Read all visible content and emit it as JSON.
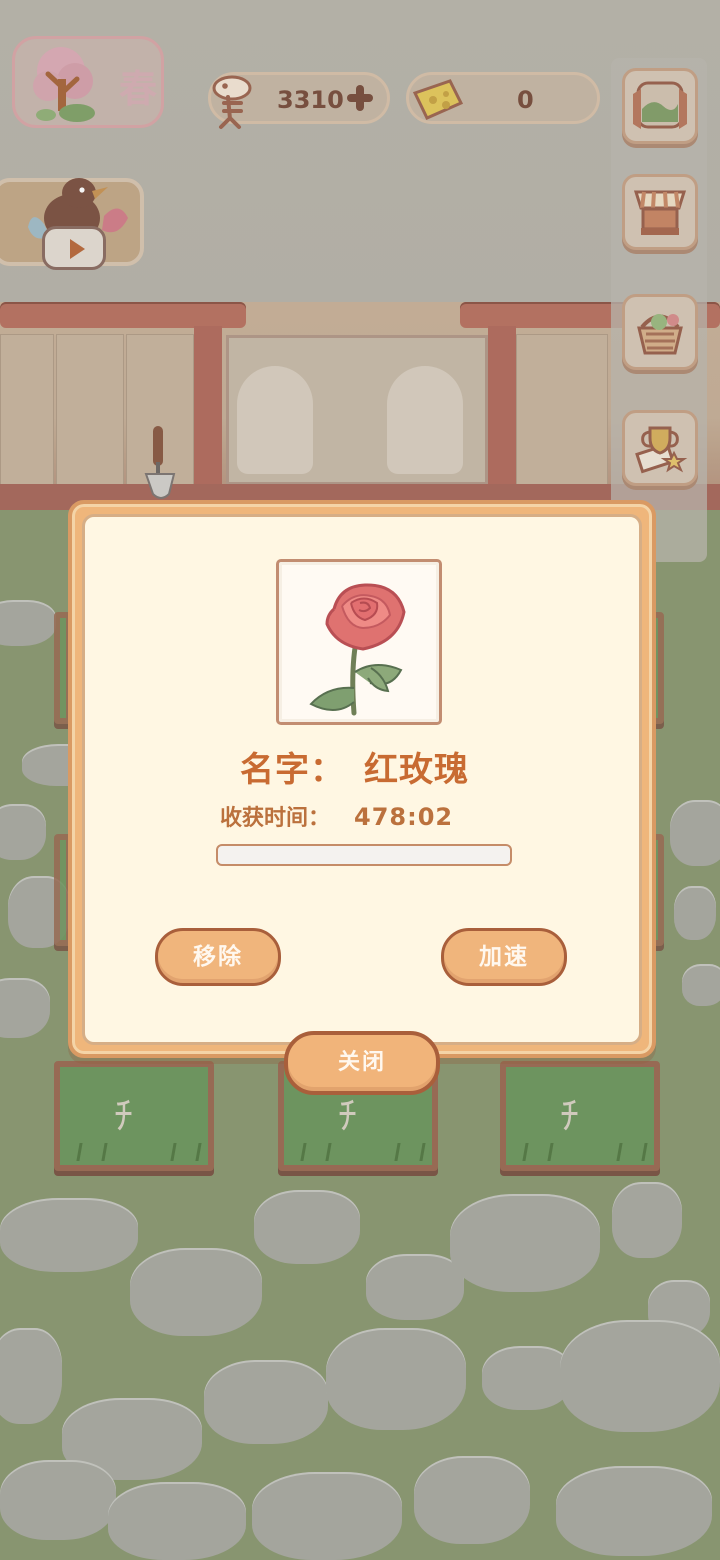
{
  "hud": {
    "season": "春",
    "fish_count": "3310",
    "cheese_count": "0"
  },
  "icons": {
    "tree": "tree-icon",
    "fish": "fish-bone-icon",
    "cheese": "cheese-icon",
    "plus": "plus-icon",
    "window": "window-icon",
    "shop": "shop-stall-icon",
    "basket": "basket-icon",
    "trophy": "trophy-icon",
    "bird": "bird-icon",
    "play": "play-icon",
    "trowel": "trowel-icon",
    "rose": "red-rose-icon"
  },
  "plant_panel": {
    "name_label": "名字：",
    "name_value": "红玫瑰",
    "harvest_label": "收获时间：",
    "harvest_value": "478:02",
    "progress_fraction": 0.0,
    "remove_button": "移除",
    "speed_button": "加速",
    "close_button": "关闭"
  },
  "colors": {
    "panel_border": "#efb67b",
    "panel_fill": "#fff7e3",
    "button_fill": "#f0b57c",
    "button_border": "#a95f3b",
    "title_text": "#c86b32",
    "body_text": "#bb713d"
  }
}
